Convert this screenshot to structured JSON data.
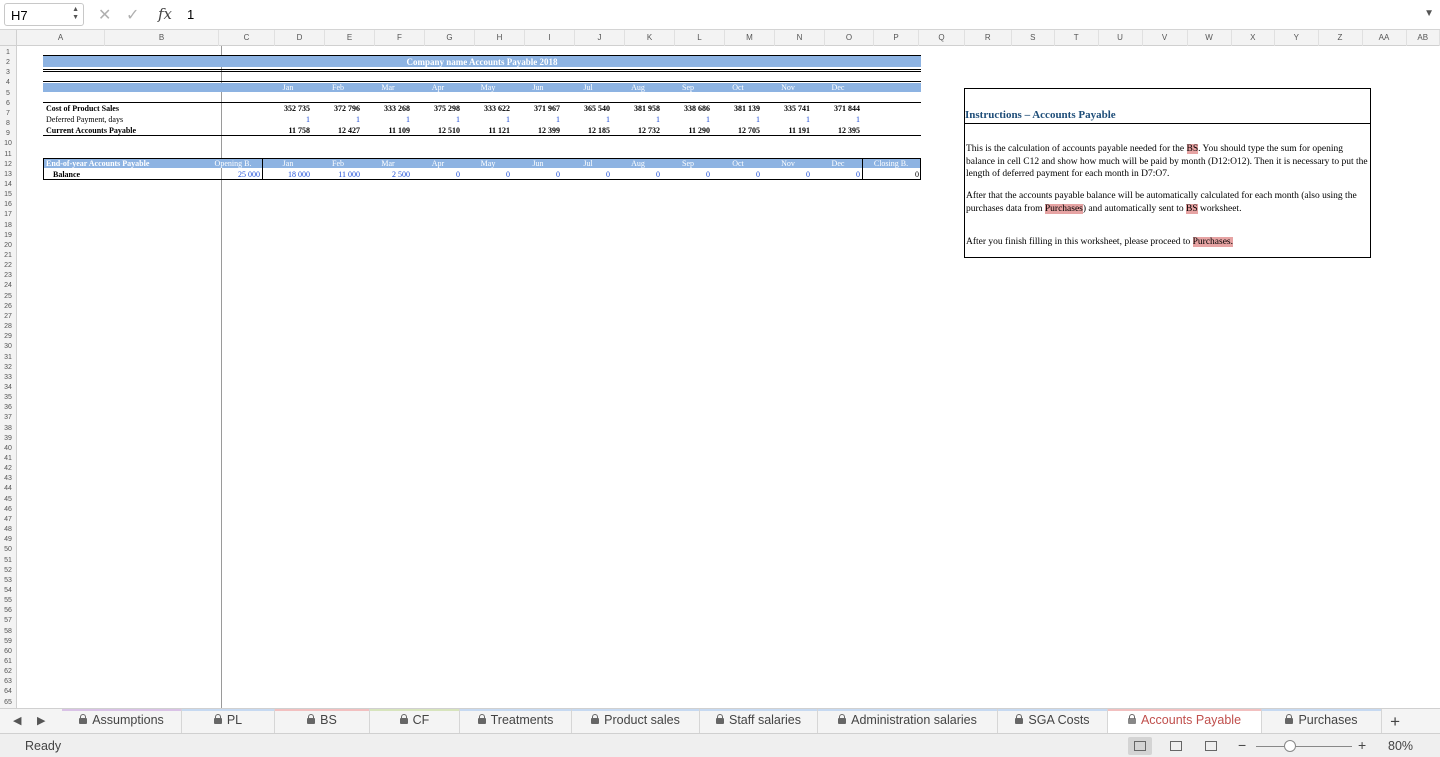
{
  "formula_bar": {
    "name_box": "H7",
    "formula_value": "1",
    "fx_label": "fx"
  },
  "columns": [
    "A",
    "B",
    "C",
    "D",
    "E",
    "F",
    "G",
    "H",
    "I",
    "J",
    "K",
    "L",
    "M",
    "N",
    "O",
    "P",
    "Q",
    "R",
    "S",
    "T",
    "U",
    "V",
    "W",
    "X",
    "Y",
    "Z",
    "AA",
    "AB"
  ],
  "rows": [
    "1",
    "2",
    "3",
    "4",
    "5",
    "6",
    "7",
    "8",
    "9",
    "10",
    "11",
    "12",
    "13",
    "14",
    "15",
    "16",
    "17",
    "18",
    "19",
    "20",
    "21",
    "22",
    "23",
    "24",
    "25",
    "26",
    "27",
    "28",
    "29",
    "30",
    "31",
    "32",
    "33",
    "34",
    "35",
    "36",
    "37",
    "38",
    "39",
    "40",
    "41",
    "42",
    "43",
    "44",
    "45",
    "46",
    "47",
    "48",
    "49",
    "50",
    "51",
    "52",
    "53",
    "54",
    "55",
    "56",
    "57",
    "58",
    "59",
    "60",
    "61",
    "62",
    "63",
    "64",
    "65"
  ],
  "sheet": {
    "title": "Company name Accounts Payable 2018",
    "months": [
      "Jan",
      "Feb",
      "Mar",
      "Apr",
      "May",
      "Jun",
      "Jul",
      "Aug",
      "Sep",
      "Oct",
      "Nov",
      "Dec"
    ],
    "cost_label": "Cost of Product Sales",
    "cost_values": [
      "352 735",
      "372 796",
      "333 268",
      "375 298",
      "333 622",
      "371 967",
      "365 540",
      "381 958",
      "338 686",
      "381 139",
      "335 741",
      "371 844"
    ],
    "deferred_label": "Deferred Payment, days",
    "deferred_values": [
      "1",
      "1",
      "1",
      "1",
      "1",
      "1",
      "1",
      "1",
      "1",
      "1",
      "1",
      "1"
    ],
    "current_label": "Current Accounts Payable",
    "current_values": [
      "11 758",
      "12 427",
      "11 109",
      "12 510",
      "11 121",
      "12 399",
      "12 185",
      "12 732",
      "11 290",
      "12 705",
      "11 191",
      "12 395"
    ],
    "eoy_label": "End-of-year Accounts Payable",
    "opening_label": "Opening B.",
    "closing_label": "Closing B.",
    "balance_label": "Balance",
    "opening_value": "25 000",
    "balance_values": [
      "18 000",
      "11 000",
      "2 500",
      "0",
      "0",
      "0",
      "0",
      "0",
      "0",
      "0",
      "0",
      "0"
    ],
    "closing_value": "0"
  },
  "instructions": {
    "title": "Instructions – Accounts Payable",
    "p1_a": "This is the calculation of accounts payable needed for the ",
    "p1_bs": "BS",
    "p1_b": ". You should type the sum for opening balance in cell C12 and show how much will be paid by month (D12:O12). Then it is necessary to put the length of deferred payment for each month in D7:O7.",
    "p2_a": "After that the accounts payable balance will be automatically calculated for each month (also using the purchases data from ",
    "p2_purchases": "Purchases",
    "p2_b": ") and automatically sent to ",
    "p2_bs": "BS",
    "p2_c": " worksheet.",
    "p3_a": "After you finish filling in this worksheet, please proceed to ",
    "p3_purchases": "Purchases."
  },
  "tabs": [
    {
      "label": "Assumptions",
      "locked": true,
      "stripe": "#d9c2e6"
    },
    {
      "label": "PL",
      "locked": true,
      "stripe": "#c6d9f1"
    },
    {
      "label": "BS",
      "locked": true,
      "stripe": "#f2c0c0"
    },
    {
      "label": "CF",
      "locked": true,
      "stripe": "#d7e4bd"
    },
    {
      "label": "Treatments",
      "locked": true,
      "stripe": "#c6d9f1"
    },
    {
      "label": "Product sales",
      "locked": true,
      "stripe": "#c6d9f1"
    },
    {
      "label": "Staff salaries",
      "locked": true,
      "stripe": "#c6d9f1"
    },
    {
      "label": "Administration salaries",
      "locked": true,
      "stripe": "#c6d9f1"
    },
    {
      "label": "SGA Costs",
      "locked": true,
      "stripe": "#c6d9f1"
    },
    {
      "label": "Accounts Payable",
      "locked": true,
      "stripe": "#f2c0c0",
      "active": true
    },
    {
      "label": "Purchases",
      "locked": true,
      "stripe": "#c6d9f1"
    }
  ],
  "status": {
    "text": "Ready",
    "zoom": "80%",
    "zoom_fraction": 0.35
  },
  "icons": {
    "cancel": "close-icon",
    "confirm": "check-icon",
    "add_sheet": "plus-icon"
  },
  "colors": {
    "header_band": "#8db3e2",
    "input_blue": "#1f4fd8",
    "highlight": "#e6a3a3",
    "active_tab_text": "#c0504d"
  }
}
